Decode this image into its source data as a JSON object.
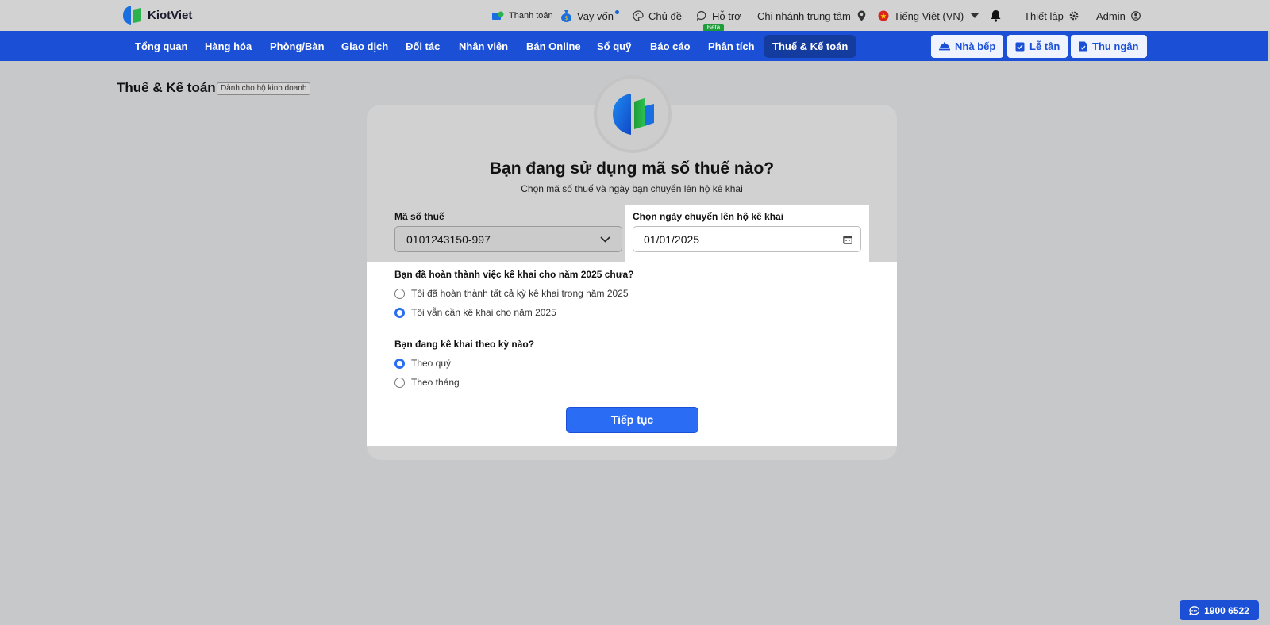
{
  "brand": {
    "name": "KiotViet"
  },
  "topbar": {
    "payment": "Thanh toán",
    "loan": "Vay vốn",
    "theme": "Chủ đề",
    "support": "Hỗ trợ",
    "support_badge": "Beta",
    "branch": "Chi nhánh trung tâm",
    "language": "Tiếng Việt (VN)",
    "settings": "Thiết lập",
    "user": "Admin"
  },
  "nav": {
    "items": [
      "Tổng quan",
      "Hàng hóa",
      "Phòng/Bàn",
      "Giao dịch",
      "Đối tác",
      "Nhân viên",
      "Bán Online",
      "Sổ quỹ",
      "Báo cáo",
      "Phân tích",
      "Thuế & Kế toán"
    ],
    "active": "Thuế & Kế toán",
    "kitchen": "Nhà bếp",
    "reception": "Lễ tân",
    "cashier": "Thu ngân"
  },
  "page": {
    "title": "Thuế & Kế toán",
    "badge": "Dành cho hộ kinh doanh"
  },
  "card": {
    "title": "Bạn đang sử dụng mã số thuế nào?",
    "subtitle": "Chọn mã số thuế và ngày bạn chuyển lên hộ kê khai",
    "tax_label": "Mã số thuế",
    "tax_value": "0101243150-997",
    "date_label": "Chọn ngày chuyển lên hộ kê khai",
    "date_value": "01/01/2025",
    "q1": "Bạn đã hoàn thành việc kê khai cho năm 2025 chưa?",
    "q1_opt1": "Tôi đã hoàn thành tất cả kỳ kê khai trong năm 2025",
    "q1_opt2": "Tôi vẫn cần kê khai cho năm 2025",
    "q2": "Bạn đang kê khai theo kỳ nào?",
    "q2_opt1": "Theo quý",
    "q2_opt2": "Theo tháng",
    "continue": "Tiếp tục"
  },
  "hotline": "1900 6522",
  "colors": {
    "primary": "#1a4fd6",
    "accent": "#2a6df4",
    "active_nav": "#143b9e"
  }
}
